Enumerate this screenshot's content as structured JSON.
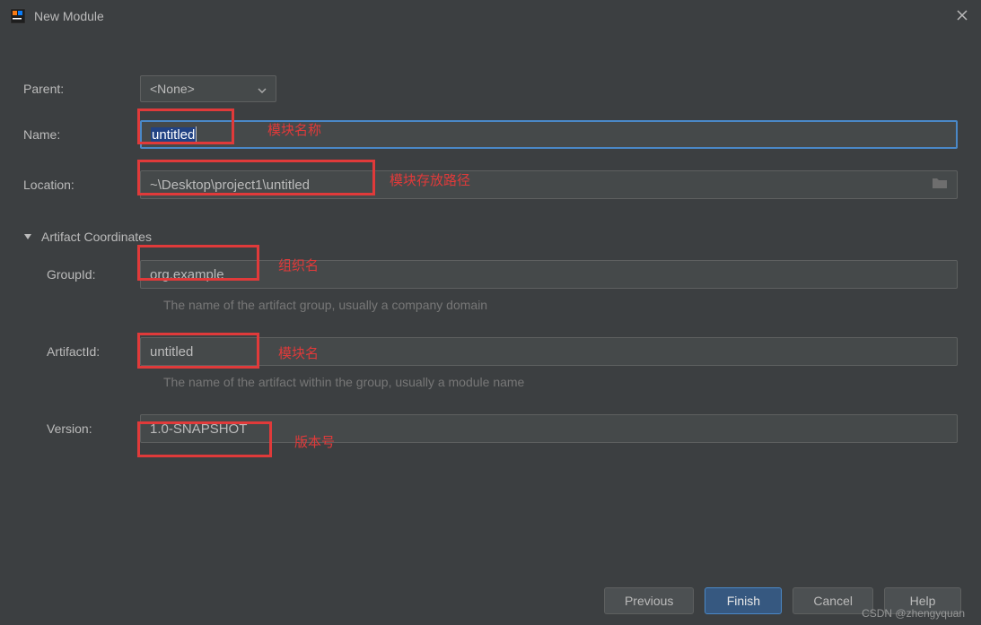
{
  "title": "New Module",
  "labels": {
    "parent": "Parent:",
    "name": "Name:",
    "location": "Location:",
    "group_id": "GroupId:",
    "artifact_id": "ArtifactId:",
    "version": "Version:",
    "section": "Artifact Coordinates"
  },
  "fields": {
    "parent": "<None>",
    "name": "untitled",
    "location": "~\\Desktop\\project1\\untitled",
    "group_id": "org.example",
    "artifact_id": "untitled",
    "version": "1.0-SNAPSHOT"
  },
  "help": {
    "group_id": "The name of the artifact group, usually a company domain",
    "artifact_id": "The name of the artifact within the group, usually a module name"
  },
  "annotations": {
    "name": "模块名称",
    "location": "模块存放路径",
    "group_id": "组织名",
    "artifact_id": "模块名",
    "version": "版本号"
  },
  "buttons": {
    "previous": "Previous",
    "finish": "Finish",
    "cancel": "Cancel",
    "help": "Help"
  },
  "watermark": "CSDN @zhengyquan"
}
